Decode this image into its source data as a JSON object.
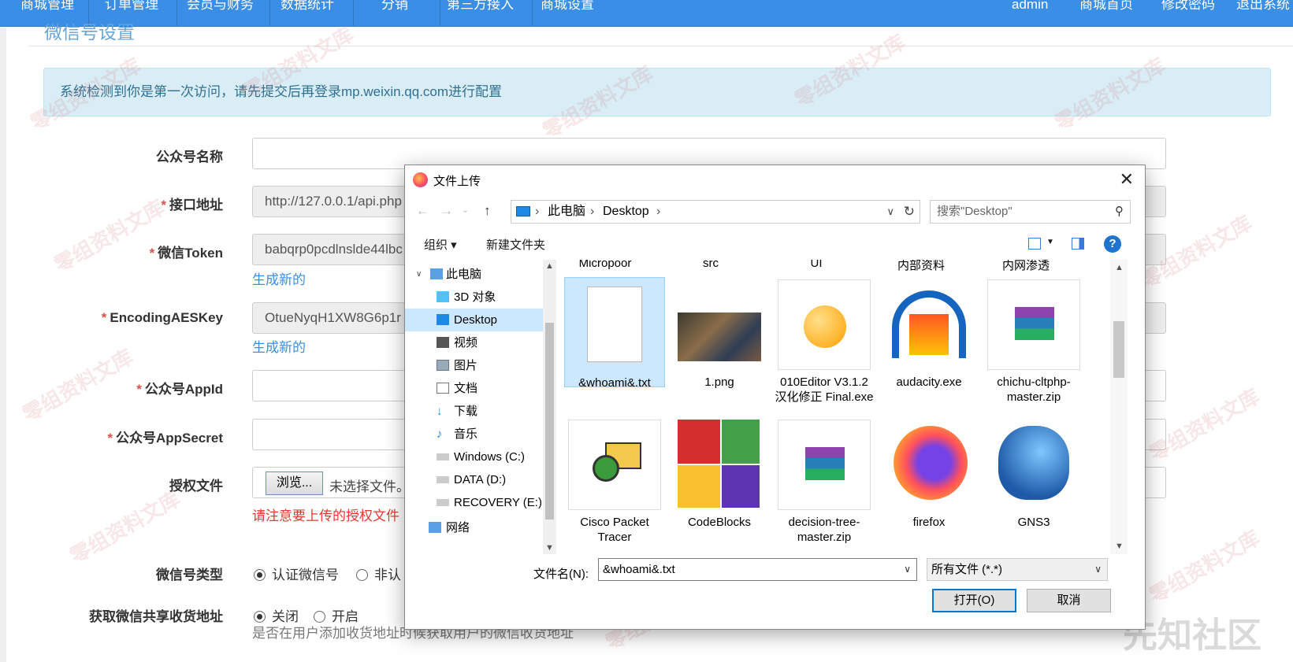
{
  "nav": {
    "items": [
      "商城管理",
      "订单管理",
      "会员与财务",
      "数据统计",
      "分销",
      "第三方接入",
      "商城设置"
    ],
    "right": [
      "admin",
      "商城首页",
      "修改密码",
      "退出系统"
    ]
  },
  "page": {
    "title": "微信号设置",
    "alert": "系统检测到你是第一次访问，请先提交后再登录mp.weixin.qq.com进行配置"
  },
  "form": {
    "name_label": "公众号名称",
    "api_label": "接口地址",
    "api_value": "http://127.0.0.1/api.php",
    "token_label": "微信Token",
    "token_value": "babqrp0pcdlnslde44lbc",
    "token_regen": "生成新的",
    "aes_label": "EncodingAESKey",
    "aes_value": "OtueNyqH1XW8G6p1r",
    "aes_regen": "生成新的",
    "appid_label": "公众号AppId",
    "secret_label": "公众号AppSecret",
    "auth_label": "授权文件",
    "browse": "浏览...",
    "no_file": "未选择文件。",
    "auth_warn": "请注意要上传的授权文件",
    "type_label": "微信号类型",
    "type_opt1": "认证微信号",
    "type_opt2": "非认",
    "addr_label": "获取微信共享收货地址",
    "addr_opt1": "关闭",
    "addr_opt2": "开启",
    "addr_help": "是否在用户添加收货地址时候获取用户的微信收货地址"
  },
  "dialog": {
    "title": "文件上传",
    "close": "✕",
    "crumb_pc": "此电脑",
    "crumb_desktop": "Desktop",
    "search_placeholder": "搜索\"Desktop\"",
    "organize": "组织 ▾",
    "new_folder": "新建文件夹",
    "tree": [
      "此电脑",
      "3D 对象",
      "Desktop",
      "视频",
      "图片",
      "文档",
      "下载",
      "音乐",
      "Windows (C:)",
      "DATA (D:)",
      "RECOVERY (E:)",
      "网络"
    ],
    "cut_row": [
      "Micropoor",
      "src",
      "UI",
      "内部资料",
      "内网渗透"
    ],
    "files": [
      {
        "name": "&whoami&.txt"
      },
      {
        "name": "1.png"
      },
      {
        "name": "010Editor V3.1.2 汉化修正 Final.exe"
      },
      {
        "name": "audacity.exe"
      },
      {
        "name": "chichu-cltphp-master.zip"
      },
      {
        "name": "Cisco Packet Tracer"
      },
      {
        "name": "CodeBlocks"
      },
      {
        "name": "decision-tree-master.zip"
      },
      {
        "name": "firefox"
      },
      {
        "name": "GNS3"
      }
    ],
    "filename_label": "文件名(N):",
    "filename_value": "&whoami&.txt",
    "filetype": "所有文件 (*.*)",
    "open": "打开(O)",
    "cancel": "取消"
  },
  "watermark": "零组资料文库",
  "corner_mark": "先知社区",
  "colors": {
    "nav": "#3a8ee6",
    "accent": "#0078d7",
    "alert_bg": "#d9edf7",
    "warn": "#e03b30"
  }
}
